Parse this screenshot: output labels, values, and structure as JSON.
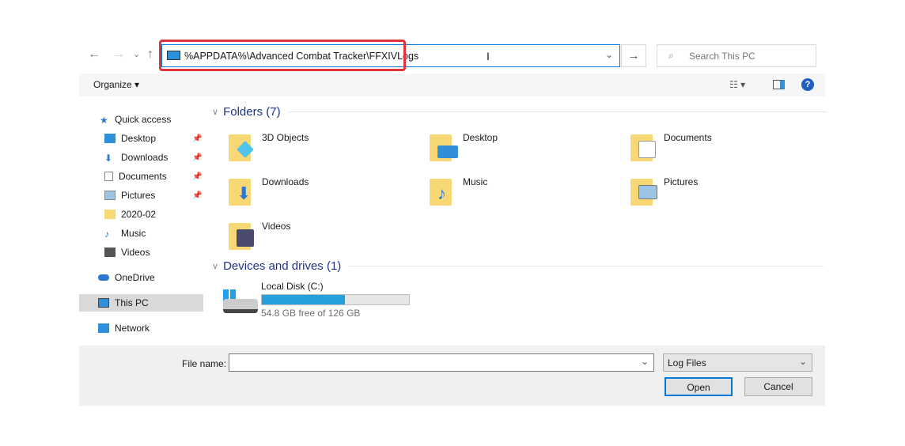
{
  "nav": {
    "back": "←",
    "forward": "→",
    "recent": "⌄",
    "up": "↑",
    "address": "%APPDATA%\\Advanced Combat Tracker\\FFXIVLogs",
    "go": "→",
    "search_placeholder": "Search This PC"
  },
  "toolbar": {
    "organize": "Organize ▾",
    "help": "?"
  },
  "sidebar": {
    "items": [
      {
        "label": "Quick access",
        "icon": "star-icon"
      },
      {
        "label": "Desktop",
        "icon": "desktop-icon",
        "pinned": true
      },
      {
        "label": "Downloads",
        "icon": "download-icon",
        "pinned": true
      },
      {
        "label": "Documents",
        "icon": "document-icon",
        "pinned": true
      },
      {
        "label": "Pictures",
        "icon": "picture-icon",
        "pinned": true
      },
      {
        "label": "2020-02",
        "icon": "folder-icon"
      },
      {
        "label": "Music",
        "icon": "music-icon"
      },
      {
        "label": "Videos",
        "icon": "video-icon"
      },
      {
        "label": "OneDrive",
        "icon": "cloud-icon"
      },
      {
        "label": "This PC",
        "icon": "pc-icon",
        "selected": true
      },
      {
        "label": "Network",
        "icon": "network-icon"
      }
    ]
  },
  "folders": {
    "title": "Folders (7)",
    "items": [
      "3D Objects",
      "Desktop",
      "Documents",
      "Downloads",
      "Music",
      "Pictures",
      "Videos"
    ]
  },
  "drives": {
    "title": "Devices and drives (1)",
    "items": [
      {
        "name": "Local Disk (C:)",
        "free": "54.8 GB free of 126 GB",
        "used_fraction": 0.565
      }
    ]
  },
  "footer": {
    "file_name_label": "File name:",
    "file_name_value": "",
    "filter": "Log Files",
    "open": "Open",
    "cancel": "Cancel"
  },
  "colors": {
    "accent": "#0078d7",
    "highlight": "#e0343c",
    "bar": "#26a0da"
  }
}
